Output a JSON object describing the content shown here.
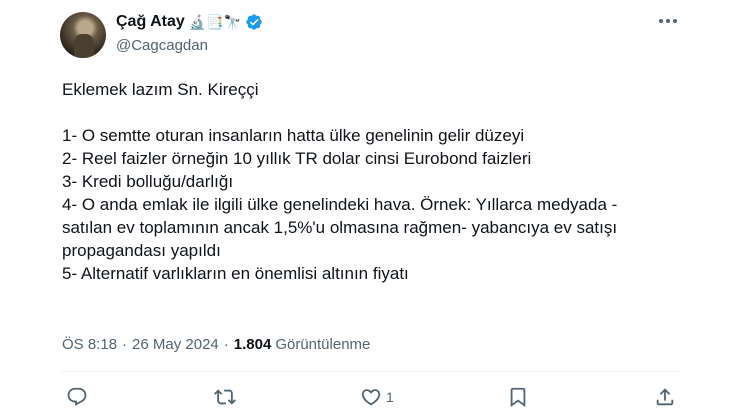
{
  "author": {
    "display_name": "Çağ Atay",
    "name_emojis": "🔬📑🔭",
    "handle": "@Cagcagdan",
    "verified": true
  },
  "tweet": {
    "lines": [
      "Eklemek lazım Sn. Kireççi",
      "",
      "1- O semtte oturan insanların hatta ülke genelinin gelir düzeyi",
      "2- Reel faizler örneğin 10 yıllık TR dolar cinsi Eurobond faizleri",
      "3- Kredi bolluğu/darlığı",
      "4- O anda emlak ile ilgili ülke genelindeki hava. Örnek: Yıllarca medyada -",
      "satılan ev toplamının ancak 1,5%'u olmasına rağmen- yabancıya ev satışı",
      "propagandası yapıldı",
      "5- Alternatif varlıkların en önemlisi altının fiyatı"
    ],
    "time": "ÖS 8:18",
    "date": "26 May 2024",
    "separator": "·",
    "views_count": "1.804",
    "views_label": "Görüntülenme"
  },
  "actions": {
    "reply_icon": "reply-icon",
    "retweet_icon": "retweet-icon",
    "like_icon": "heart-icon",
    "like_count": "1",
    "bookmark_icon": "bookmark-icon",
    "share_icon": "share-icon"
  },
  "colors": {
    "text": "#0f1419",
    "secondary": "#536471",
    "verified": "#1d9bf0",
    "divider": "#eff3f4"
  }
}
